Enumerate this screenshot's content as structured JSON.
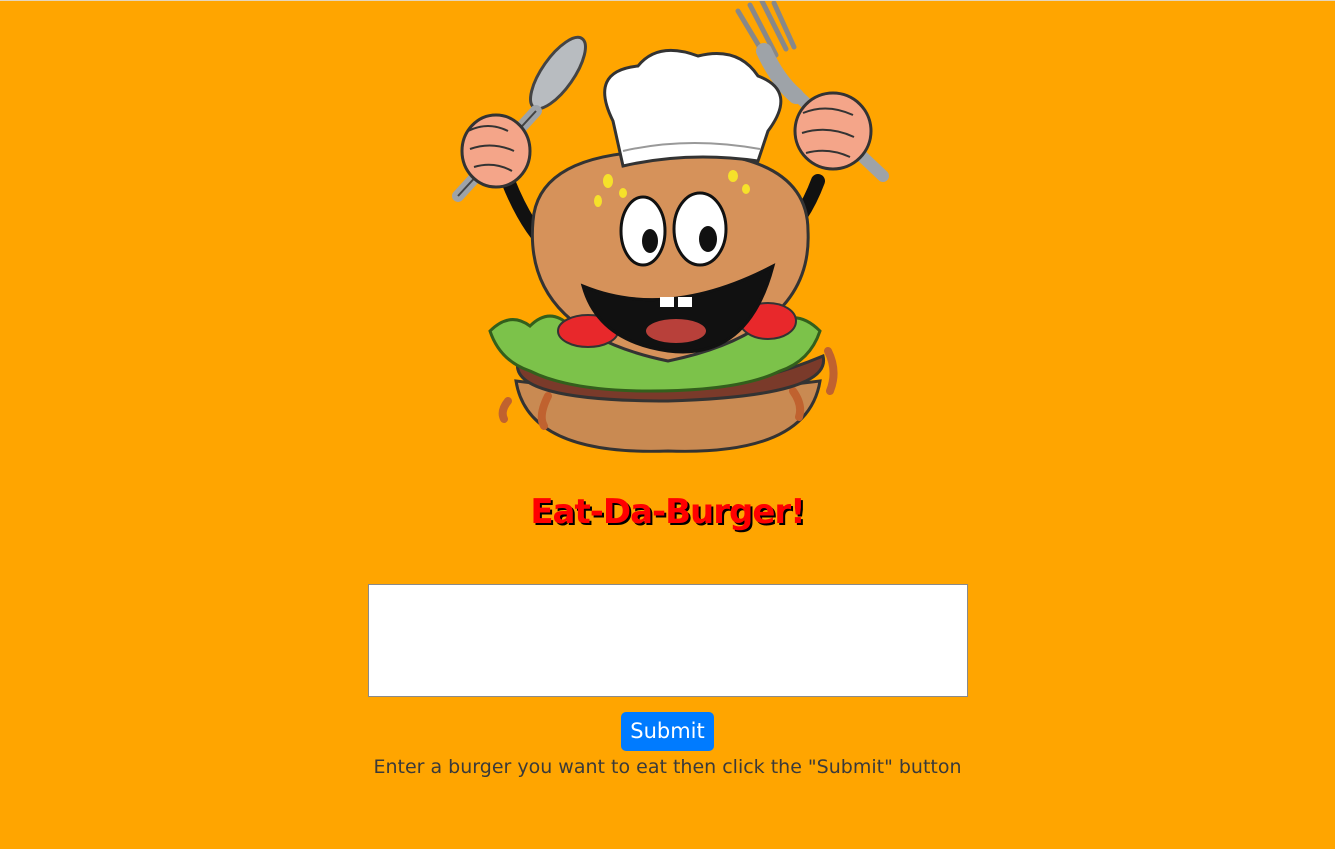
{
  "header": {
    "title": "Eat-Da-Burger!",
    "mascot_icon": "burger-chef-mascot-icon"
  },
  "form": {
    "input_value": "",
    "submit_label": "Submit",
    "hint": "Enter a burger you want to eat then click the \"Submit\" button"
  },
  "colors": {
    "background": "#ffa500",
    "title": "#ff0000",
    "button": "#007bff"
  }
}
